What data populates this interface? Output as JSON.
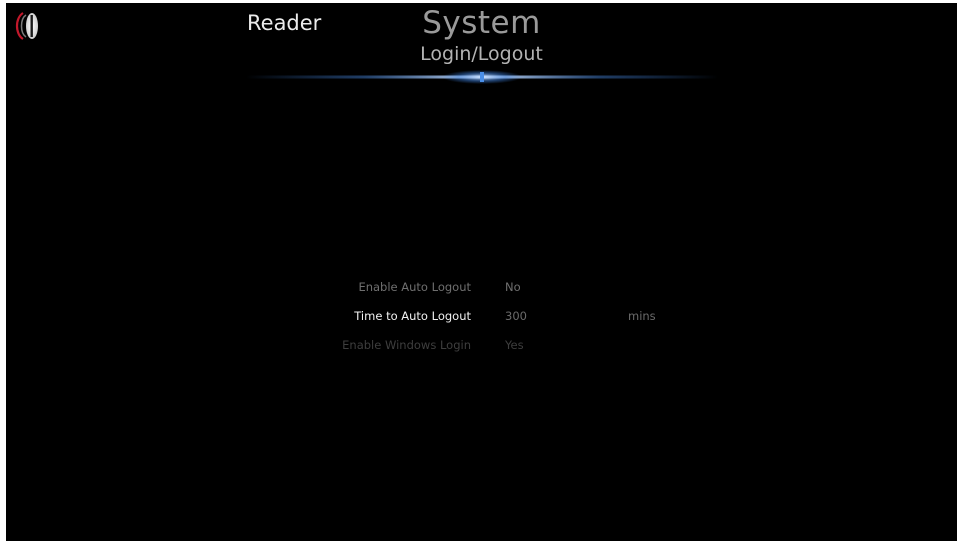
{
  "header": {
    "prev_section": "Reader",
    "title": "System",
    "subtitle": "Login/Logout",
    "logo_icon": "brand-logo-icon"
  },
  "settings": [
    {
      "label": "Enable Auto Logout",
      "value": "No",
      "unit": ""
    },
    {
      "label": "Time to Auto Logout",
      "value": "300",
      "unit": "mins"
    },
    {
      "label": "Enable Windows Login",
      "value": "Yes",
      "unit": ""
    }
  ],
  "colors": {
    "background": "#000000",
    "accent_glow": "#3a7bd5",
    "text_focus": "#f2f2f2",
    "text_dim": "#6f6f6f"
  }
}
